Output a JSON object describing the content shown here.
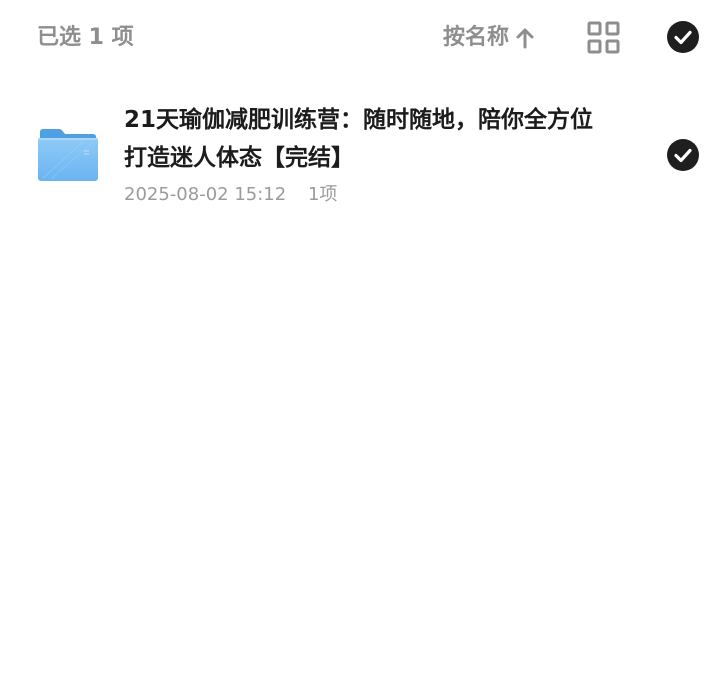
{
  "header": {
    "selected_label": "已选 1 项",
    "sort_label": "按名称",
    "sort_icon": "arrow-up-icon",
    "view_icon": "grid-view-icon",
    "select_all_icon": "check-circle-icon"
  },
  "files": [
    {
      "icon": "folder-icon",
      "name": "21天瑜伽减肥训练营：随时随地，陪你全方位打造迷人体态【完结】",
      "date": "2025-08-02 15:12",
      "count": "1项",
      "selected": true
    }
  ],
  "colors": {
    "header_text": "#8e8e8e",
    "title_text": "#1c1c1c",
    "meta_text": "#9b9b9b",
    "check_fill": "#1f1f1f",
    "folder_blue": "#6ab4f2"
  }
}
